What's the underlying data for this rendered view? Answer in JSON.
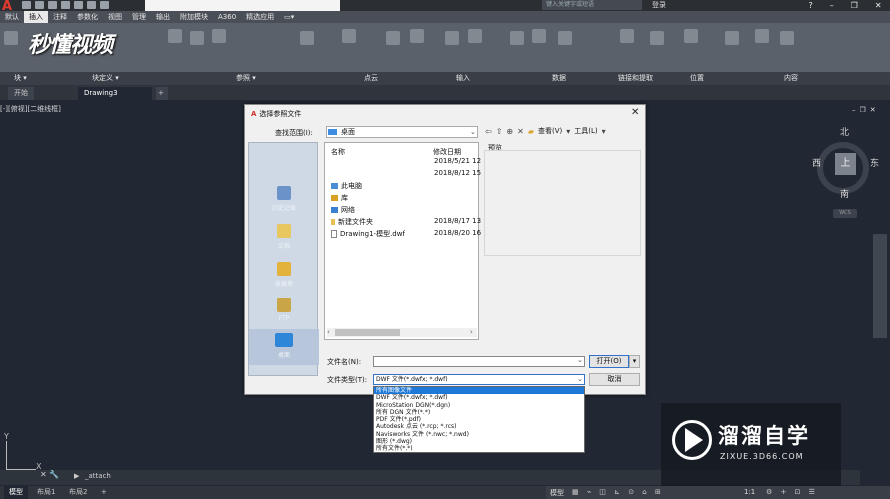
{
  "titlebar": {
    "search_placeholder": "键入关键字或短语",
    "login_label": "登录"
  },
  "menu_tabs": [
    "默认",
    "插入",
    "注释",
    "参数化",
    "视图",
    "管理",
    "输出",
    "附加模块",
    "A360",
    "精选应用"
  ],
  "ribbon": {
    "watermark_logo": "秒懂视频",
    "panels": [
      "块 ▾",
      "块定义 ▾",
      "参照 ▾",
      "点云",
      "输入",
      "数据",
      "链接和提取",
      "位置",
      "内容"
    ]
  },
  "doc_tabs": [
    "开始",
    "Drawing3"
  ],
  "viewport": {
    "label": "[-][俯视][二维线框]",
    "compass": {
      "north": "北",
      "south": "南",
      "east": "东",
      "west": "西",
      "top": "上"
    },
    "wcs": "WCS"
  },
  "dialog": {
    "title": "选择参照文件",
    "lookin_label": "查找范围(I):",
    "lookin_value": "桌面",
    "view_label": "查看(V)",
    "tools_label": "工具(L)",
    "places": [
      "历史记录",
      "文档",
      "收藏夹",
      "FTP",
      "桌面"
    ],
    "columns": {
      "name": "名称",
      "date": "修改日期"
    },
    "files": [
      {
        "name": "",
        "date": "2018/5/21 12"
      },
      {
        "name": "",
        "date": "2018/8/12 15"
      },
      {
        "name": "此电脑",
        "date": ""
      },
      {
        "name": "库",
        "date": ""
      },
      {
        "name": "网络",
        "date": ""
      },
      {
        "name": "新建文件夹",
        "date": "2018/8/17 13"
      },
      {
        "name": "Drawing1-模型.dwf",
        "date": "2018/8/20 16"
      }
    ],
    "preview_label": "预览",
    "filename_label": "文件名(N):",
    "filename_value": "",
    "filetype_label": "文件类型(T):",
    "filetype_value": "DWF 文件(*.dwfx; *.dwf)",
    "open_button": "打开(O)",
    "cancel_button": "取消",
    "filetype_options": [
      "所有图像文件",
      "DWF 文件(*.dwfx; *.dwf)",
      "MicroStation DGN(*.dgn)",
      "所有 DGN 文件(*.*)",
      "PDF 文件(*.pdf)",
      "Autodesk 点云 (*.rcp; *.rcs)",
      "Navisworks 文件 (*.nwc; *.nwd)",
      "图形 (*.dwg)",
      "所有文件(*.*)"
    ],
    "selected_option_index": 0
  },
  "commandline": {
    "text": "_attach"
  },
  "layout_tabs": [
    "模型",
    "布局1",
    "布局2"
  ],
  "statusbar": {
    "model": "模型",
    "scale": "1:1"
  },
  "watermark": {
    "title": "溜溜自学",
    "url": "ZIXUE.3D66.COM"
  },
  "colors": {
    "accent": "#1e78d7",
    "app_red": "#e23a2e",
    "background": "#212833"
  }
}
